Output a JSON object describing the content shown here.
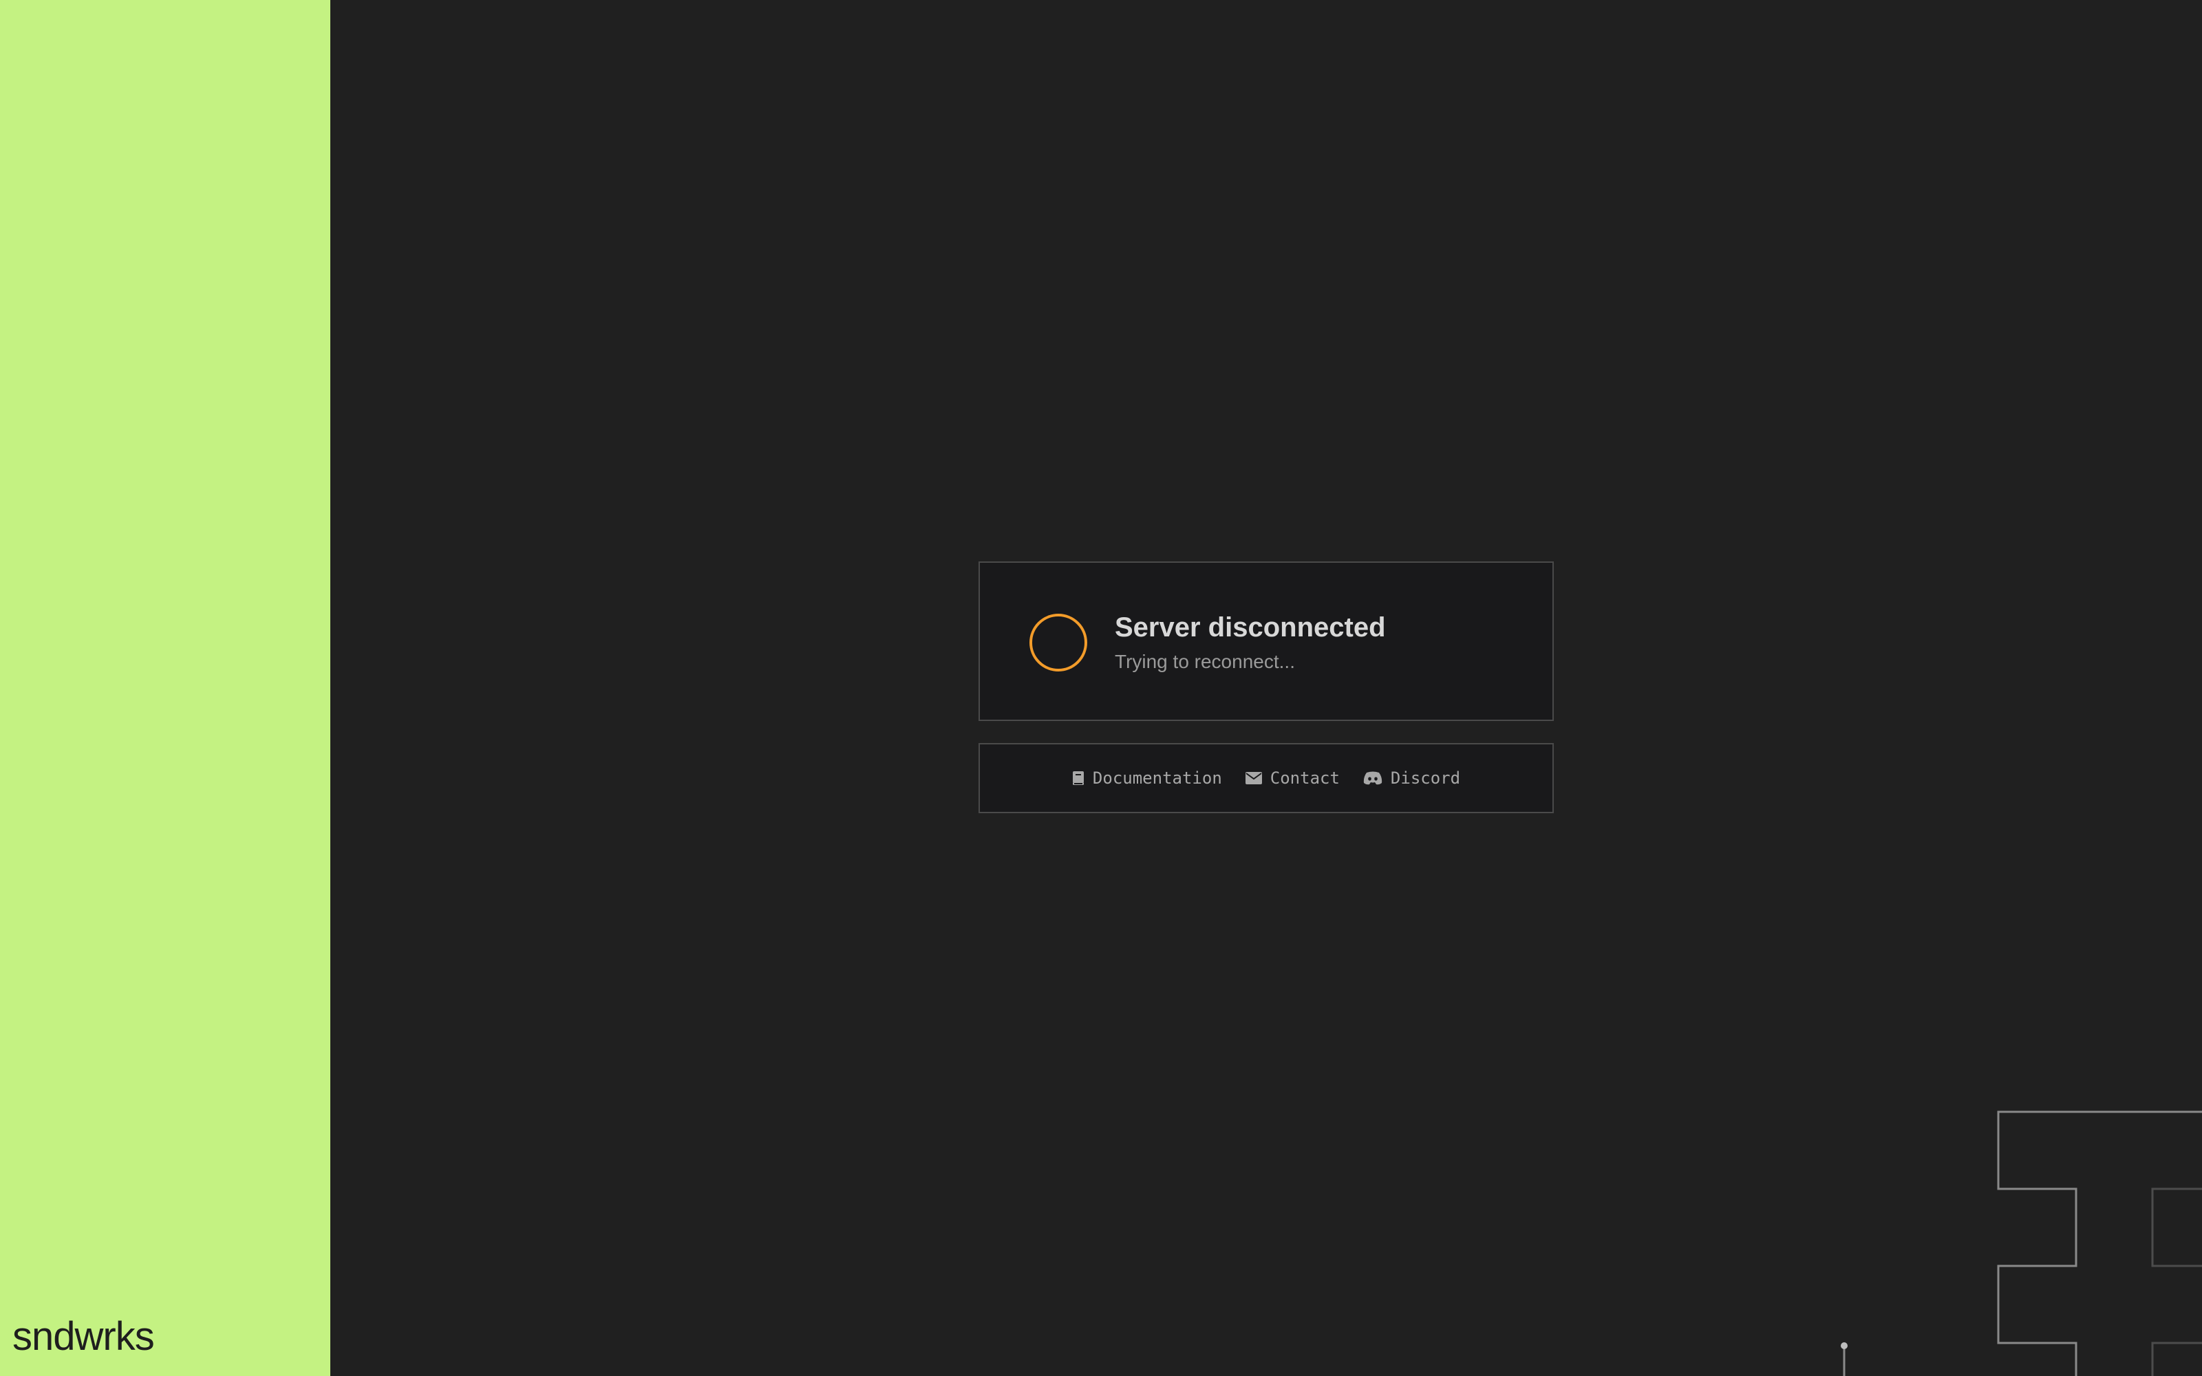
{
  "brand": {
    "name": "sndwrks"
  },
  "status": {
    "title": "Server disconnected",
    "subtitle": "Trying to reconnect...",
    "ring_color": "#f39c2a"
  },
  "links": [
    {
      "label": "Documentation",
      "icon": "book-icon"
    },
    {
      "label": "Contact",
      "icon": "envelope-icon"
    },
    {
      "label": "Discord",
      "icon": "discord-icon"
    }
  ],
  "colors": {
    "sidebar": "#c4f282",
    "background": "#202020",
    "card": "#19191b",
    "accent": "#f39c2a"
  }
}
